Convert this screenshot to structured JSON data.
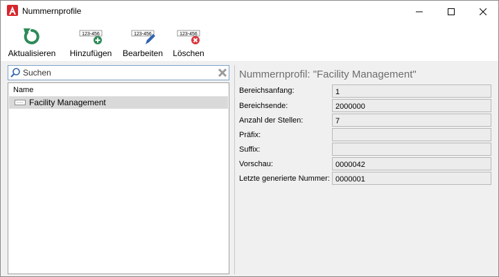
{
  "window": {
    "title": "Nummernprofile"
  },
  "toolbar": {
    "refresh_label": "Aktualisieren",
    "add_label": "Hinzufügen",
    "edit_label": "Bearbeiten",
    "delete_label": "Löschen",
    "badge_text": "123-456"
  },
  "search": {
    "placeholder": "Suchen"
  },
  "list": {
    "column_header": "Name",
    "items": [
      {
        "label": "Facility Management"
      }
    ]
  },
  "detail": {
    "title": "Nummernprofil: \"Facility Management\"",
    "fields": [
      {
        "label": "Bereichsanfang:",
        "value": "1"
      },
      {
        "label": "Bereichsende:",
        "value": "2000000"
      },
      {
        "label": "Anzahl der Stellen:",
        "value": "7"
      },
      {
        "label": "Präfix:",
        "value": ""
      },
      {
        "label": "Suffix:",
        "value": ""
      },
      {
        "label": "Vorschau:",
        "value": "0000042"
      },
      {
        "label": "Letzte generierte Nummer:",
        "value": "0000001"
      }
    ]
  },
  "colors": {
    "accent": "#2e8a57",
    "delete": "#d9363e",
    "edit": "#2f64b0",
    "app_icon": "#d7262b"
  }
}
